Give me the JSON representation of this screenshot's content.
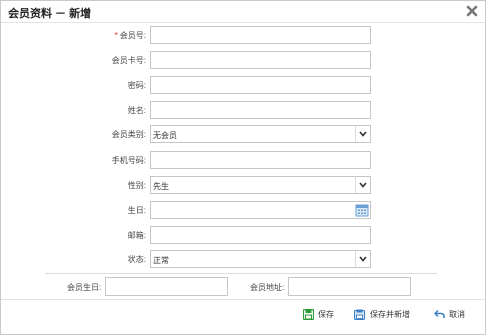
{
  "dialog": {
    "title": "会员资料 － 新增"
  },
  "form": {
    "required_mark": "*",
    "member_no": {
      "label": "会员号:",
      "value": ""
    },
    "card_no": {
      "label": "会员卡号:",
      "value": ""
    },
    "password": {
      "label": "密码:",
      "value": ""
    },
    "name": {
      "label": "姓名:",
      "value": ""
    },
    "member_type": {
      "label": "会员类别:",
      "value": "无会员"
    },
    "phone": {
      "label": "手机号码:",
      "value": ""
    },
    "gender": {
      "label": "性别:",
      "value": "先生"
    },
    "birthday": {
      "label": "生日:",
      "value": ""
    },
    "email": {
      "label": "邮箱:",
      "value": ""
    },
    "status": {
      "label": "状态:",
      "value": "正常"
    }
  },
  "extra": {
    "member_birthday": {
      "label": "会员生日:",
      "value": ""
    },
    "member_address": {
      "label": "会员地址:",
      "value": ""
    }
  },
  "footer": {
    "save_label": "保存",
    "save_new_label": "保存并新增",
    "cancel_label": "取消"
  },
  "colors": {
    "required": "#e02020",
    "save_icon": "#2e9b3a",
    "save_new_icon": "#3a7fc4",
    "cancel_icon": "#3a7fc4",
    "calendar_icon": "#6a9fd4"
  },
  "icons": {
    "close": "close-icon",
    "dropdown": "chevron-down-icon",
    "calendar": "calendar-icon",
    "save": "save-icon",
    "save_new": "save-new-icon",
    "cancel": "undo-icon"
  }
}
